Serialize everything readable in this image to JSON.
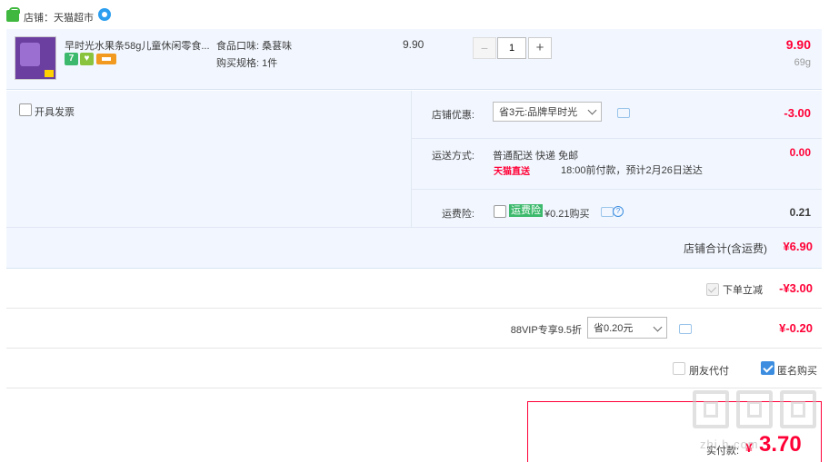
{
  "store": {
    "label": "店铺：天猫超市"
  },
  "item": {
    "title": "早时光水果条58g儿童休闲零食...",
    "badges": [
      "7",
      "♥"
    ],
    "sku_flavor": "食品口味:  桑葚味",
    "sku_spec": "购买规格:  1件",
    "unit_price": "9.90",
    "qty_minus": "−",
    "qty_value": "1",
    "qty_plus": "+",
    "total_price": "9.90",
    "weight": "69g"
  },
  "options": {
    "invoice_label": "开具发票",
    "coupon_label": "店铺优惠:",
    "coupon_selected": "省3元:品牌早时光",
    "coupon_amount": "-3.00",
    "shipping_label": "运送方式:",
    "shipping_method": "普通配送 快递 免邮",
    "tmall_direct": "天猫直送",
    "shipping_note": "18:00前付款，预计2月26日送达",
    "shipping_amount": "0.00",
    "insurance_label": "运费险:",
    "insurance_badge": "运费险",
    "insurance_price": "¥0.21购买",
    "insurance_help": "?",
    "insurance_amount": "0.21",
    "store_total_label": "店铺合计(含运费)",
    "store_total_value": "¥6.90"
  },
  "discount": {
    "label": "下单立减",
    "amount": "-¥3.00"
  },
  "vip": {
    "label": "88VIP专享9.5折",
    "selected": "省0.20元",
    "amount": "¥-0.20"
  },
  "checkout": {
    "friend_pay_label": "朋友代付",
    "anonymous_label": "匿名购买",
    "pay_label": "实付款:",
    "pay_currency": "¥",
    "pay_amount": "3.70"
  },
  "watermark": {
    "text": "zhi.h.com"
  },
  "colors": {
    "accent": "#ff0036",
    "panel_bg": "#f2f7ff",
    "check_blue": "#3c8de0",
    "tmall_green": "#40b83f"
  }
}
